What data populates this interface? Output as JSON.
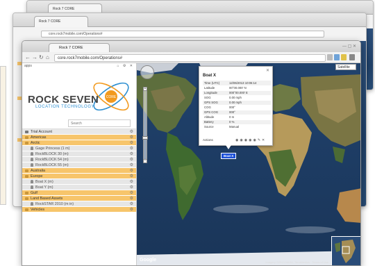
{
  "background_windows": [
    {
      "tab": "Rock 7 CORE",
      "url": "core.rock7mobile.com/Operations#"
    },
    {
      "tab": "Rock 7 CORE",
      "url": "core.rock7mobile.com/Operations#"
    }
  ],
  "browser": {
    "tab_title": "Rock 7 CORE",
    "url": "core.rock7mobile.com/Operations#"
  },
  "app": {
    "app_label": "apps",
    "logo_text": "ROCK SEVEN",
    "logo_sub": "LOCATION TECHNOLOGY",
    "logo_badge": "CORE",
    "search_placeholder": "Search"
  },
  "tree": [
    {
      "label": "Trial Account",
      "kind": "root"
    },
    {
      "label": "Americas",
      "kind": "group"
    },
    {
      "label": "Arctic",
      "kind": "group"
    },
    {
      "label": "Gage Princess (1 m)",
      "kind": "device"
    },
    {
      "label": "RockBLOCK 30 (m)",
      "kind": "device"
    },
    {
      "label": "RockBLOCK 54 (m)",
      "kind": "device"
    },
    {
      "label": "RockBLOCK 55 (m)",
      "kind": "device"
    },
    {
      "label": "Australia",
      "kind": "group"
    },
    {
      "label": "Europe",
      "kind": "group"
    },
    {
      "label": "Boat X (m)",
      "kind": "device"
    },
    {
      "label": "Boat Y (m)",
      "kind": "device"
    },
    {
      "label": "Gulf",
      "kind": "group"
    },
    {
      "label": "Land Based Assets",
      "kind": "group"
    },
    {
      "label": "RockSTAR 2010 (m in)",
      "kind": "device"
    },
    {
      "label": "Vehicles",
      "kind": "group"
    }
  ],
  "map": {
    "map_type": "Satellite",
    "google": "Google",
    "copyright": "Imagery ©2013 NASA, TerraMetrics · Terms of Use",
    "marker_label": "Boat X"
  },
  "popup": {
    "title": "Boat X",
    "rows": [
      {
        "k": "Time (UTC)",
        "v": "12/06/2013 10:06:14"
      },
      {
        "k": "Latitude",
        "v": "00°00.000' N"
      },
      {
        "k": "Longitude",
        "v": "000°00.000' E"
      },
      {
        "k": "SOG",
        "v": "0.00 mph"
      },
      {
        "k": "GPS SOG",
        "v": "0.00 mph"
      },
      {
        "k": "COG",
        "v": "000°"
      },
      {
        "k": "GPS COG",
        "v": "000°"
      },
      {
        "k": "Altitude",
        "v": "0 m"
      },
      {
        "k": "Battery",
        "v": "0 %"
      },
      {
        "k": "Source",
        "v": "Manual"
      }
    ],
    "actions_label": "Actions"
  },
  "colors": {
    "orange_row": "#f7c56b",
    "grey_row": "#e6e6e6",
    "ocean": "#1d3a62",
    "brand_blue": "#2d8fd1",
    "marker": "#1b4fd8"
  }
}
